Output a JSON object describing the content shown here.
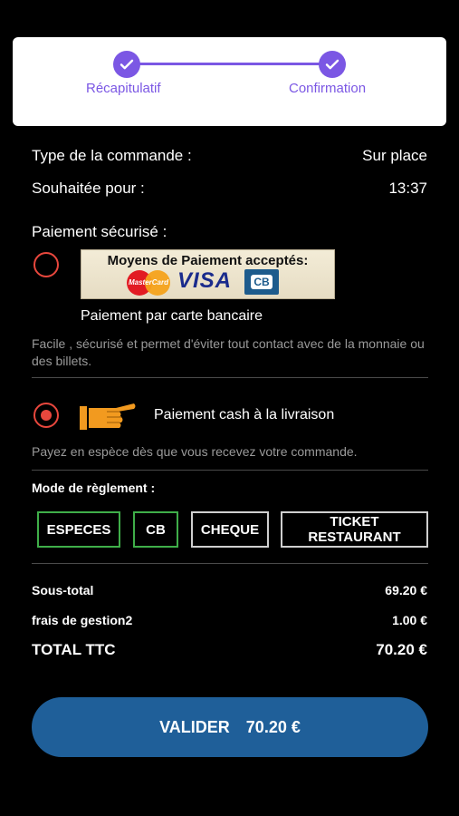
{
  "stepper": {
    "steps": [
      {
        "label": "Récapitulatif",
        "done": true
      },
      {
        "label": "Confirmation",
        "done": true
      }
    ],
    "accent_color": "#7b57e4"
  },
  "order": {
    "type_label": "Type de la commande :",
    "type_value": "Sur place",
    "time_label": "Souhaitée pour :",
    "time_value": "13:37"
  },
  "payment": {
    "section_label": "Paiement sécurisé :",
    "card": {
      "banner_title": "Moyens de Paiement acceptés:",
      "mastercard_text": "MasterCard",
      "visa_text": "VISA",
      "cb_text": "CB",
      "label": "Paiement par carte bancaire",
      "description": "Facile , sécurisé et permet d'éviter tout contact avec de la monnaie ou des billets.",
      "selected": false
    },
    "cash": {
      "label": "Paiement cash à la livraison",
      "description": "Payez en espèce dès que vous recevez votre commande.",
      "selected": true
    },
    "radio_color": "#e8473d"
  },
  "settlement": {
    "label": "Mode de règlement :",
    "options": [
      {
        "label": "ESPECES",
        "selected": true
      },
      {
        "label": "CB",
        "selected": true
      },
      {
        "label": "CHEQUE",
        "selected": false
      },
      {
        "label": "TICKET RESTAURANT",
        "selected": false
      }
    ],
    "selected_color": "#3fae49"
  },
  "totals": {
    "subtotal_label": "Sous-total",
    "subtotal_value": "69.20 €",
    "fees_label": "frais de gestion2",
    "fees_value": "1.00 €",
    "total_label": "TOTAL TTC",
    "total_value": "70.20 €"
  },
  "validate": {
    "label": "VALIDER",
    "amount": "70.20 €",
    "color": "#1f5f99"
  }
}
